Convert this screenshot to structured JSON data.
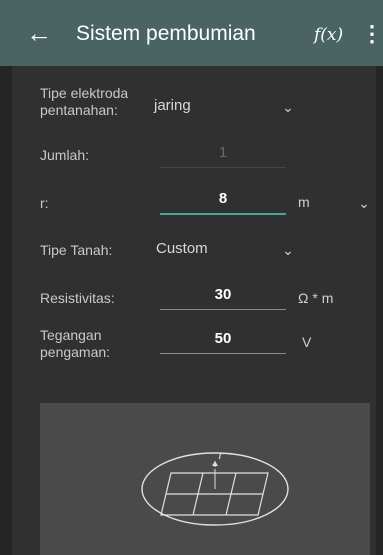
{
  "appbar": {
    "back_icon": "arrow-left-icon",
    "title": "Sistem pembumian",
    "function_label": "f(x)",
    "more_icon": "more-vert-icon",
    "color": "#4a6464"
  },
  "form": {
    "electrode_type": {
      "label": "Tipe elektroda pentanahan:",
      "value": "jaring"
    },
    "count": {
      "label": "Jumlah:",
      "value": "1"
    },
    "r": {
      "label": "r:",
      "value": "8",
      "unit": "m"
    },
    "soil_type": {
      "label": "Tipe Tanah:",
      "value": "Custom"
    },
    "resistivity": {
      "label": "Resistivitas:",
      "value": "30",
      "unit": "Ω * m"
    },
    "voltage": {
      "label": "Tegangan pengaman:",
      "value": "50",
      "unit": "V"
    }
  },
  "diagram": {
    "r_label": "r",
    "accent": "#3fa89a"
  }
}
